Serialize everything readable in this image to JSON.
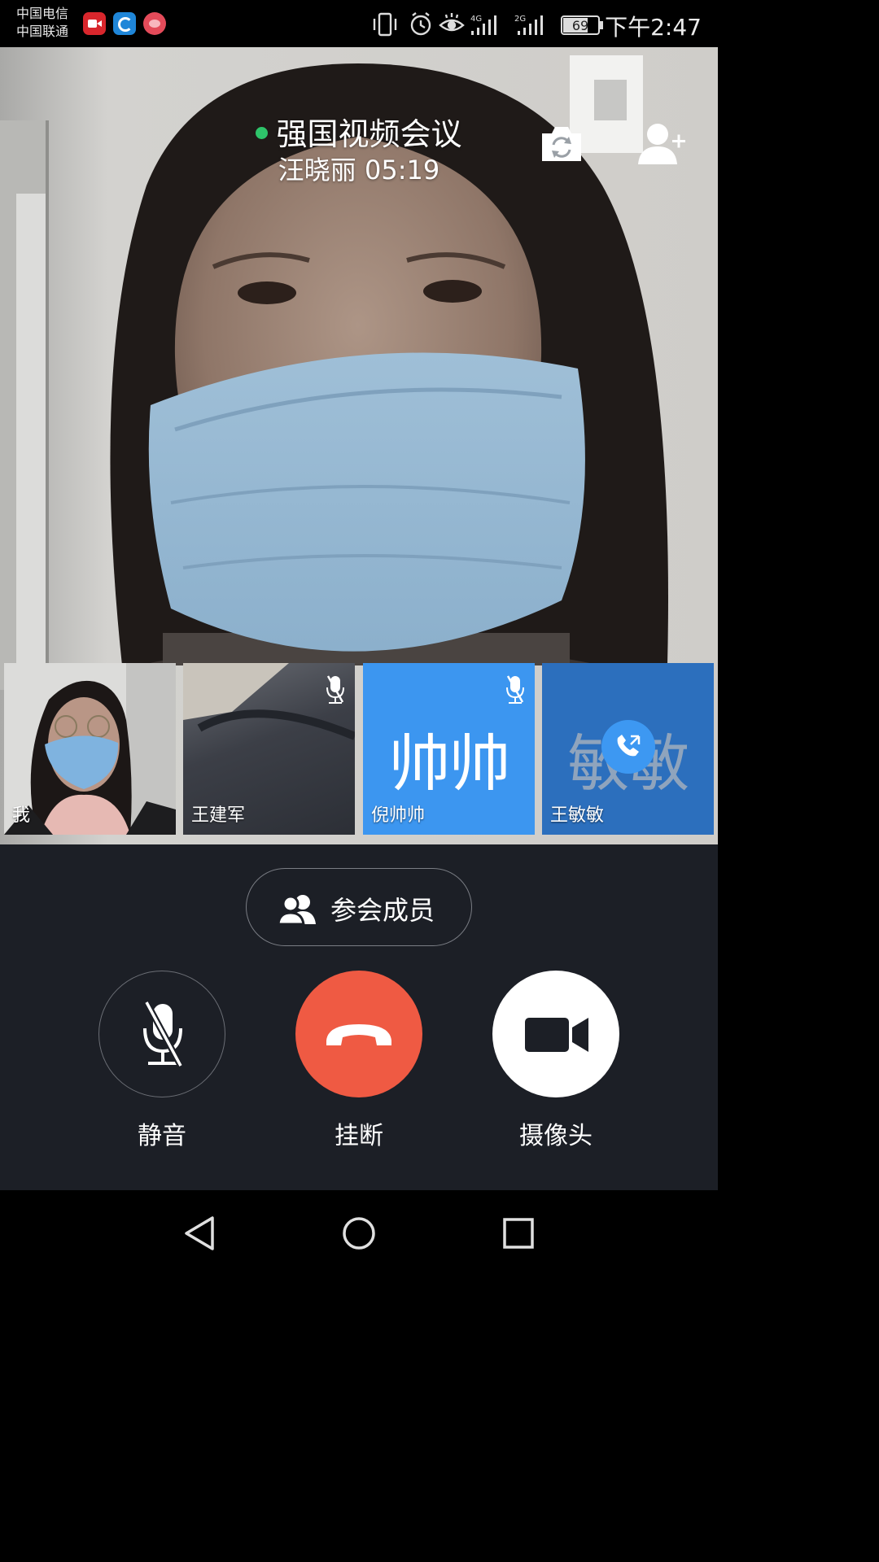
{
  "status_bar": {
    "carrier_1": "中国电信",
    "carrier_2": "中国联通",
    "app_icons": [
      "video-app-icon",
      "browser-app-icon",
      "pig-app-icon"
    ],
    "system_icons": [
      "vibrate-icon",
      "alarm-icon",
      "eye-comfort-icon",
      "signal-4g-icon",
      "signal-2g-icon",
      "battery-icon"
    ],
    "network_1": "4G",
    "network_2": "2G",
    "battery": "69",
    "time": "下午2:47"
  },
  "call": {
    "title": "强国视频会议",
    "speaker": "汪晓丽",
    "duration": "05:19",
    "status_color": "#2ec46a"
  },
  "participants": [
    {
      "name": "我",
      "type": "video",
      "muted": false
    },
    {
      "name": "王建军",
      "type": "video",
      "muted": true
    },
    {
      "name": "倪帅帅",
      "type": "avatar",
      "avatar_text": "帅帅",
      "muted": true,
      "color": "#3c96f0"
    },
    {
      "name": "王敏敏",
      "type": "avatar",
      "avatar_text": "敏敏",
      "muted": false,
      "calling": true,
      "color": "#2c6fbd"
    }
  ],
  "controls": {
    "members_label": "参会成员",
    "mute_label": "静音",
    "hangup_label": "挂断",
    "camera_label": "摄像头",
    "hangup_color": "#ef5a43",
    "panel_color": "#1c1f26"
  },
  "nav_bar": [
    "back-icon",
    "home-icon",
    "recent-apps-icon"
  ]
}
